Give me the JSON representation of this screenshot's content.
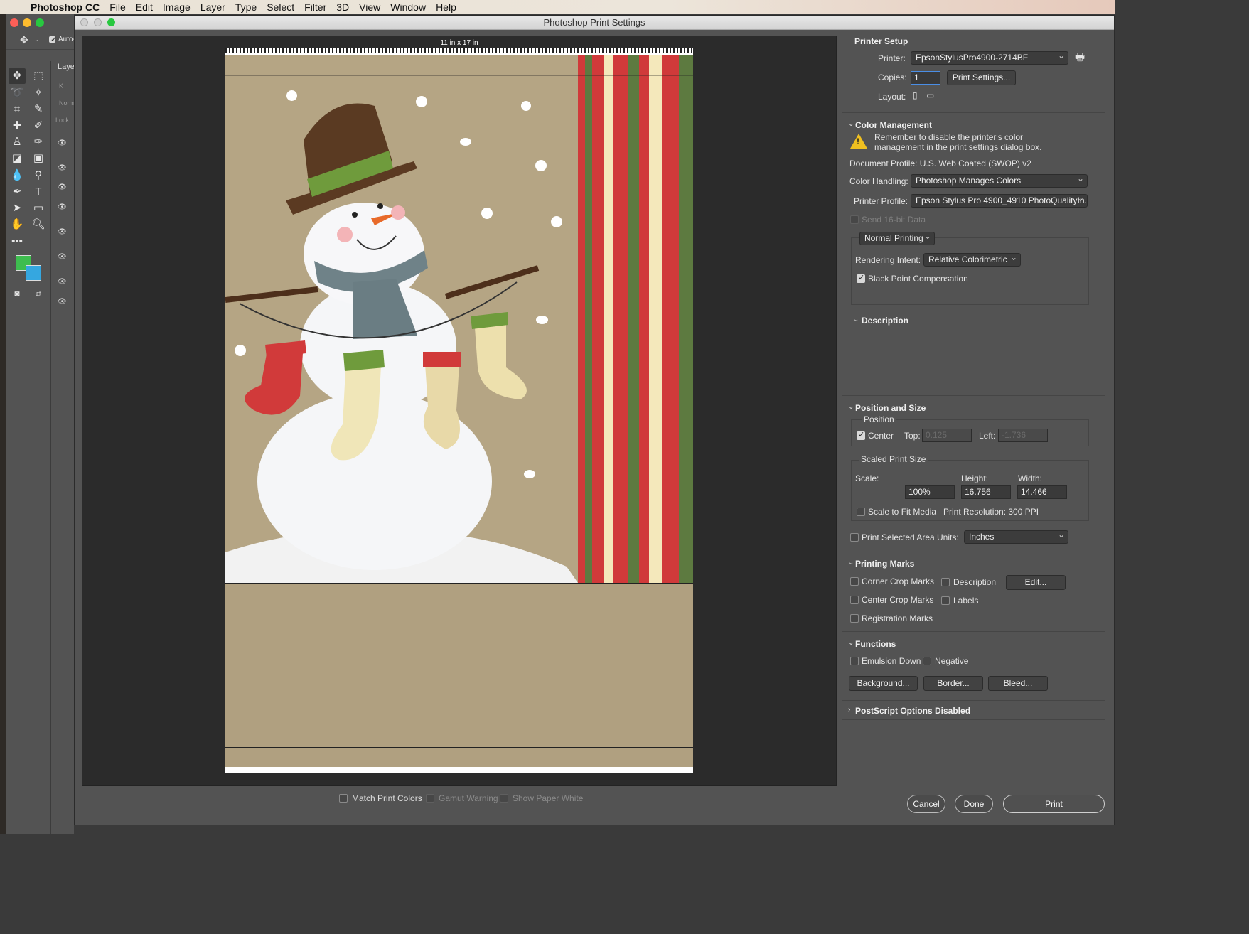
{
  "menubar": {
    "app_name": "Photoshop CC",
    "items": [
      "File",
      "Edit",
      "Image",
      "Layer",
      "Type",
      "Select",
      "Filter",
      "3D",
      "View",
      "Window",
      "Help"
    ]
  },
  "photoshop": {
    "options_label": "Auto-",
    "layers_label": "Layer",
    "layers_search": "K",
    "layers_mode": "Norm",
    "layers_lock": "Lock:"
  },
  "dialog": {
    "title": "Photoshop Print Settings",
    "paper_size": "11 in x 17 in"
  },
  "printer_setup": {
    "title": "Printer Setup",
    "printer_label": "Printer:",
    "printer_value": "EpsonStylusPro4900-2714BF",
    "copies_label": "Copies:",
    "copies_value": "1",
    "print_settings_button": "Print Settings...",
    "layout_label": "Layout:"
  },
  "color_management": {
    "title": "Color Management",
    "warning": "Remember to disable the printer's color management in the print settings dialog box.",
    "warning_line1": "Remember to disable the printer's color",
    "warning_line2": "management in the print settings dialog box.",
    "document_profile": "Document Profile: U.S. Web Coated (SWOP) v2",
    "color_handling_label": "Color Handling:",
    "color_handling_value": "Photoshop Manages Colors",
    "printer_profile_label": "Printer Profile:",
    "printer_profile_value": "Epson Stylus Pro 4900_4910 PhotoQualityIn...",
    "send_16bit": "Send 16-bit Data",
    "normal_printing": "Normal Printing",
    "rendering_intent_label": "Rendering Intent:",
    "rendering_intent_value": "Relative Colorimetric",
    "black_point": "Black Point Compensation",
    "black_point_checked": true
  },
  "description": {
    "title": "Description"
  },
  "position_size": {
    "title": "Position and Size",
    "position_label": "Position",
    "center_label": "Center",
    "center_checked": true,
    "top_label": "Top:",
    "top_value": "0.125",
    "left_label": "Left:",
    "left_value": "-1.736",
    "scaled_label": "Scaled Print Size",
    "scale_label": "Scale:",
    "scale_value": "100%",
    "height_label": "Height:",
    "height_value": "16.756",
    "width_label": "Width:",
    "width_value": "14.466",
    "scale_to_fit": "Scale to Fit Media",
    "print_resolution": "Print Resolution: 300 PPI",
    "print_selected_area": "Print Selected Area",
    "units_label": "Units:",
    "units_value": "Inches"
  },
  "printing_marks": {
    "title": "Printing Marks",
    "corner_crop": "Corner Crop Marks",
    "description": "Description",
    "edit_button": "Edit...",
    "center_crop": "Center Crop Marks",
    "labels": "Labels",
    "registration": "Registration Marks"
  },
  "functions": {
    "title": "Functions",
    "emulsion_down": "Emulsion Down",
    "negative": "Negative",
    "background_button": "Background...",
    "border_button": "Border...",
    "bleed_button": "Bleed..."
  },
  "postscript": {
    "title": "PostScript Options Disabled"
  },
  "preview_options": {
    "match_print_colors": "Match Print Colors",
    "gamut_warning": "Gamut Warning",
    "show_paper_white": "Show Paper White"
  },
  "footer": {
    "cancel": "Cancel",
    "done": "Done",
    "print": "Print"
  },
  "colors": {
    "foreground": "#3ebd4f",
    "background": "#35a7e0",
    "kraft_paper": "#b0a080",
    "stripe_red": "#d03a3a",
    "stripe_green": "#5d7a40",
    "stripe_cream": "#f4e8bb"
  }
}
